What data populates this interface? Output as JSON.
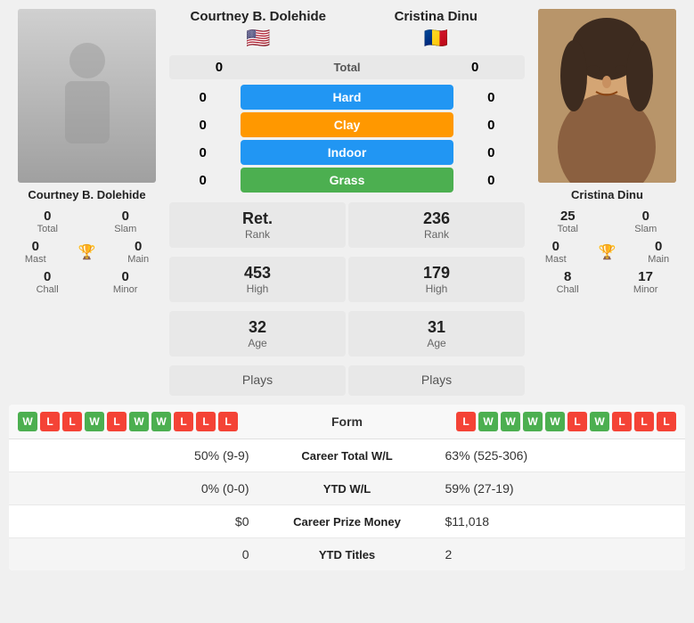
{
  "players": {
    "left": {
      "name": "Courtney B. Dolehide",
      "flag": "🇺🇸",
      "rank": "Ret.",
      "rank_label": "Rank",
      "high": "453",
      "high_label": "High",
      "age": "32",
      "age_label": "Age",
      "plays_label": "Plays",
      "total": "0",
      "total_label": "Total",
      "slam": "0",
      "slam_label": "Slam",
      "mast": "0",
      "mast_label": "Mast",
      "main": "0",
      "main_label": "Main",
      "chall": "0",
      "chall_label": "Chall",
      "minor": "0",
      "minor_label": "Minor"
    },
    "right": {
      "name": "Cristina Dinu",
      "flag": "🇷🇴",
      "rank": "236",
      "rank_label": "Rank",
      "high": "179",
      "high_label": "High",
      "age": "31",
      "age_label": "Age",
      "plays_label": "Plays",
      "total": "25",
      "total_label": "Total",
      "slam": "0",
      "slam_label": "Slam",
      "mast": "0",
      "mast_label": "Mast",
      "main": "0",
      "main_label": "Main",
      "chall": "8",
      "chall_label": "Chall",
      "minor": "17",
      "minor_label": "Minor"
    }
  },
  "surfaces": {
    "total_label": "Total",
    "left_total": "0",
    "right_total": "0",
    "items": [
      {
        "label": "Hard",
        "class": "badge-hard",
        "left": "0",
        "right": "0"
      },
      {
        "label": "Clay",
        "class": "badge-clay",
        "left": "0",
        "right": "0"
      },
      {
        "label": "Indoor",
        "class": "badge-indoor",
        "left": "0",
        "right": "0"
      },
      {
        "label": "Grass",
        "class": "badge-grass",
        "left": "0",
        "right": "0"
      }
    ]
  },
  "form": {
    "label": "Form",
    "left": [
      "W",
      "L",
      "L",
      "W",
      "L",
      "W",
      "W",
      "L",
      "L",
      "L"
    ],
    "right": [
      "L",
      "W",
      "W",
      "W",
      "W",
      "L",
      "W",
      "L",
      "L",
      "L"
    ]
  },
  "stats": [
    {
      "label": "Career Total W/L",
      "left": "50% (9-9)",
      "right": "63% (525-306)"
    },
    {
      "label": "YTD W/L",
      "left": "0% (0-0)",
      "right": "59% (27-19)"
    },
    {
      "label": "Career Prize Money",
      "left": "$0",
      "right": "$11,018"
    },
    {
      "label": "YTD Titles",
      "left": "0",
      "right": "2"
    }
  ]
}
